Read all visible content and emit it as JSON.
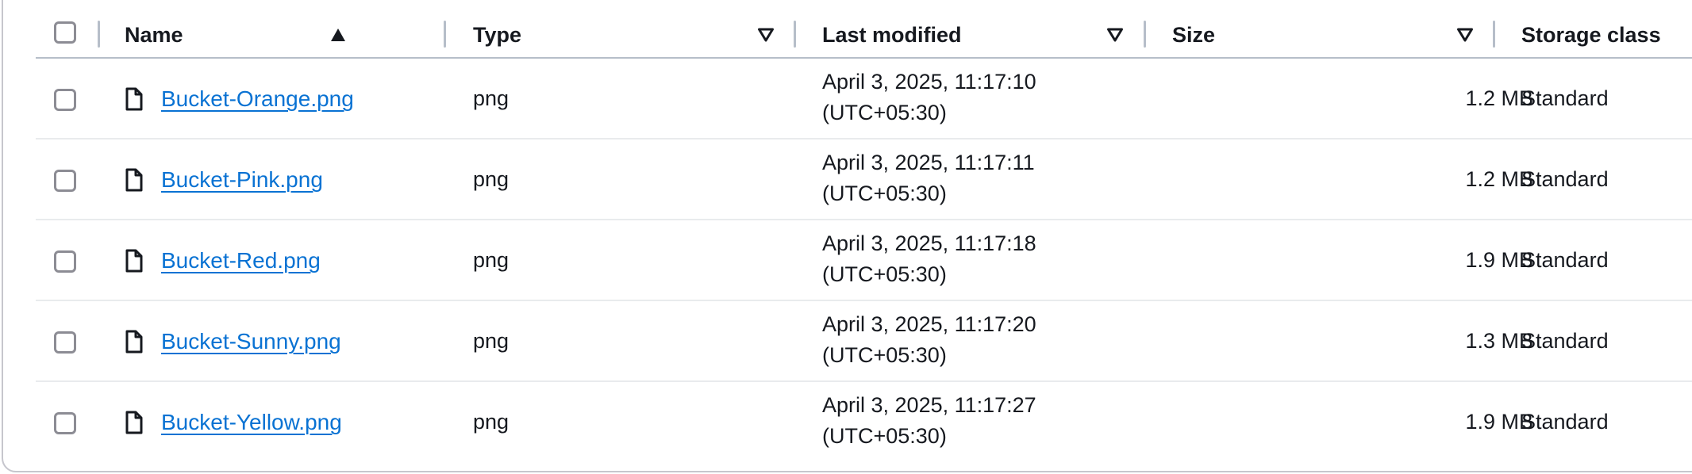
{
  "columns": {
    "name": "Name",
    "type": "Type",
    "last_modified": "Last modified",
    "size": "Size",
    "storage_class": "Storage class"
  },
  "sort": {
    "column": "Name",
    "direction": "ascending"
  },
  "rows": [
    {
      "name": "Bucket-Orange.png",
      "type": "png",
      "date": "April 3, 2025, 11:17:10",
      "tz": "(UTC+05:30)",
      "size": "1.2 MB",
      "storage": "Standard"
    },
    {
      "name": "Bucket-Pink.png",
      "type": "png",
      "date": "April 3, 2025, 11:17:11",
      "tz": "(UTC+05:30)",
      "size": "1.2 MB",
      "storage": "Standard"
    },
    {
      "name": "Bucket-Red.png",
      "type": "png",
      "date": "April 3, 2025, 11:17:18",
      "tz": "(UTC+05:30)",
      "size": "1.9 MB",
      "storage": "Standard"
    },
    {
      "name": "Bucket-Sunny.png",
      "type": "png",
      "date": "April 3, 2025, 11:17:20",
      "tz": "(UTC+05:30)",
      "size": "1.3 MB",
      "storage": "Standard"
    },
    {
      "name": "Bucket-Yellow.png",
      "type": "png",
      "date": "April 3, 2025, 11:17:27",
      "tz": "(UTC+05:30)",
      "size": "1.9 MB",
      "storage": "Standard"
    }
  ],
  "colors": {
    "link": "#0972d3",
    "text": "#16191f",
    "divider": "#b6bec9",
    "checkbox_border": "#8c8c94"
  },
  "icons": {
    "file": "file-icon",
    "sort_asc": "caret-up-filled-icon",
    "sort_unsorted": "caret-down-outline-icon"
  }
}
